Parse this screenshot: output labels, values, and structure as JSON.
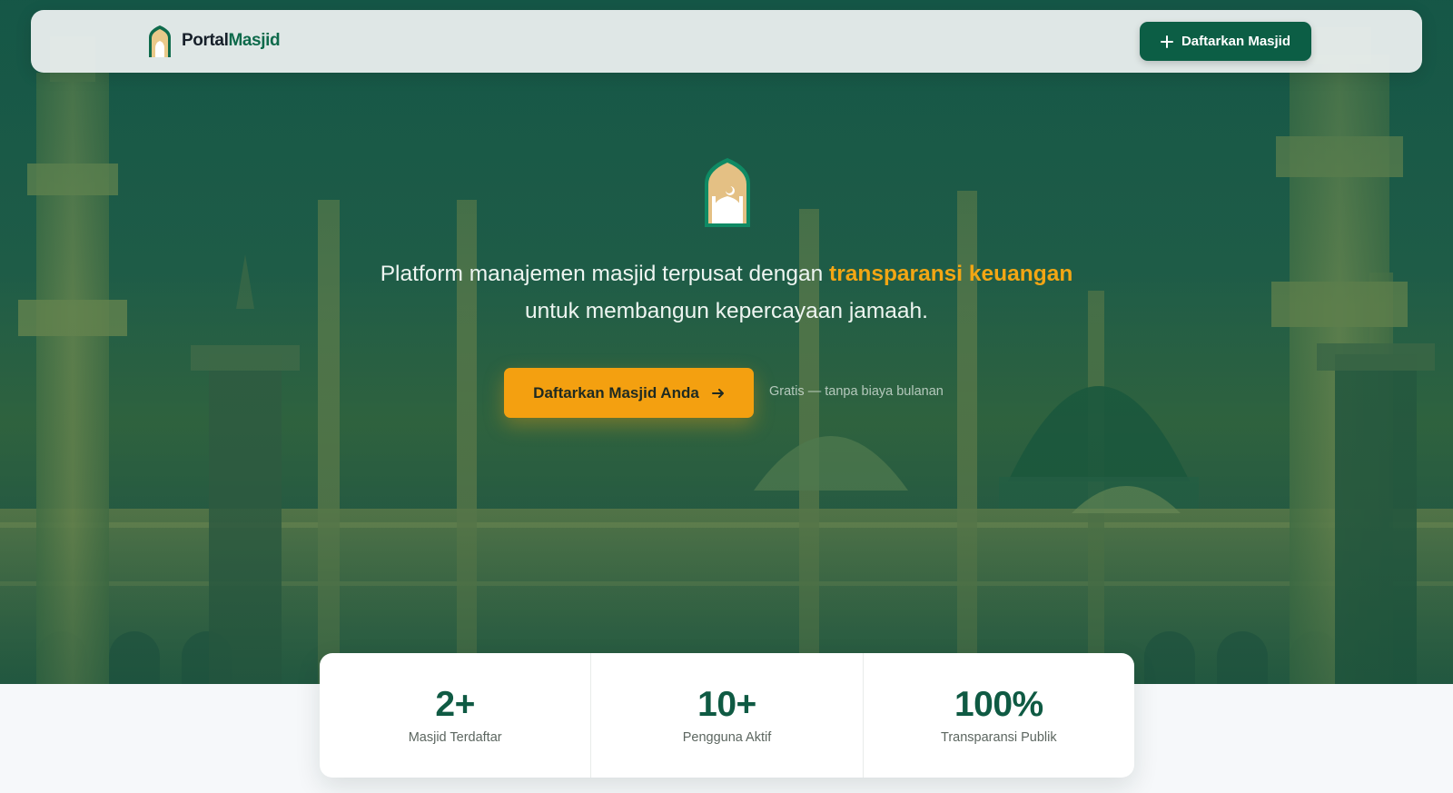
{
  "navbar": {
    "brand_part1": "Portal",
    "brand_part2": "Masjid",
    "register_button": "Daftarkan Masjid"
  },
  "hero": {
    "tagline_1": "Platform manajemen masjid terpusat dengan ",
    "tagline_highlight": "transparansi keuangan",
    "tagline_2": " untuk membangun kepercayaan jamaah.",
    "cta_button": "Daftarkan Masjid Anda",
    "cta_note": "Gratis — tanpa biaya bulanan"
  },
  "stats": [
    {
      "value": "2+",
      "label": "Masjid Terdaftar"
    },
    {
      "value": "10+",
      "label": "Pengguna Aktif"
    },
    {
      "value": "100%",
      "label": "Transparansi Publik"
    }
  ],
  "colors": {
    "primary_green": "#0c5e45",
    "accent_orange": "#f4a010",
    "highlight_orange": "#f3a614"
  },
  "icons": {
    "logo": "mosque-logo-icon",
    "plus": "plus-icon",
    "arrow": "arrow-right-icon"
  }
}
